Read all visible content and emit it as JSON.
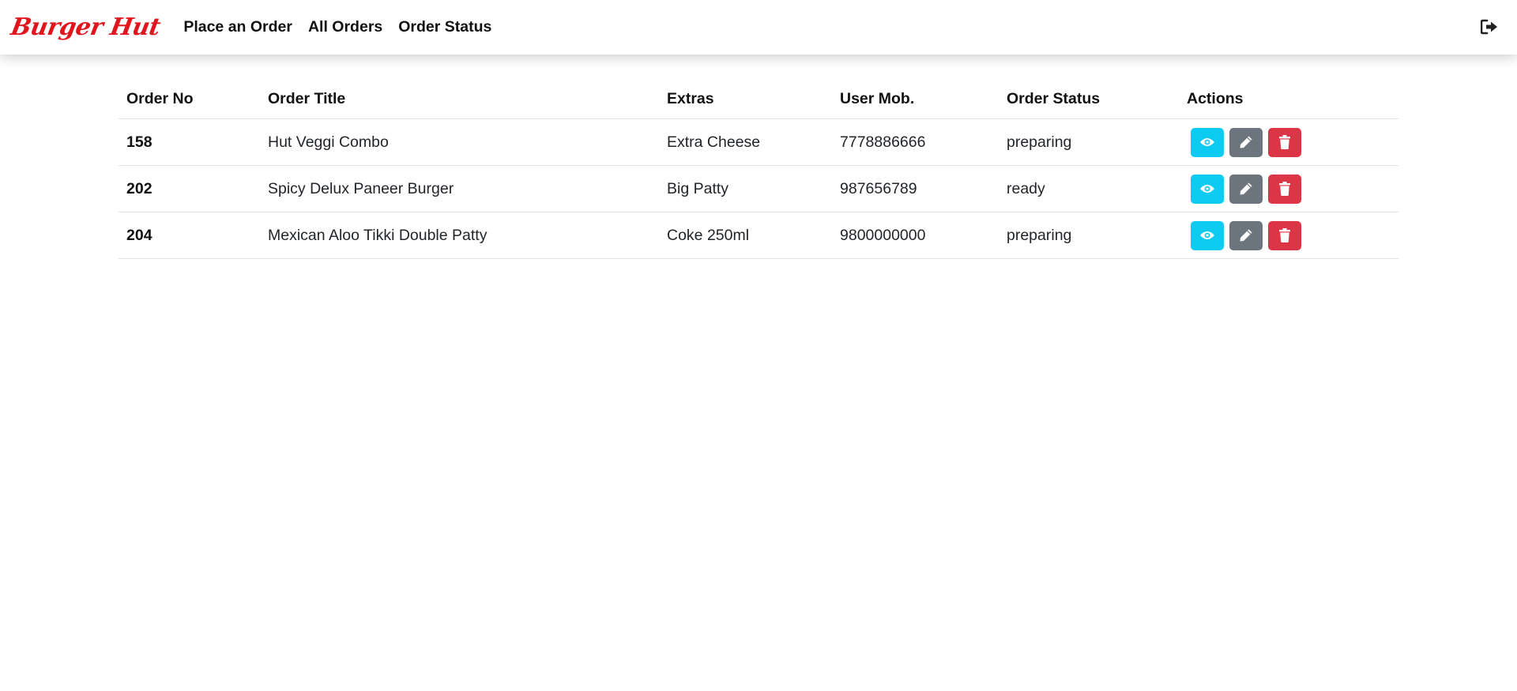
{
  "brand": "Burger Hut",
  "nav": {
    "items": [
      "Place an Order",
      "All Orders",
      "Order Status"
    ]
  },
  "colors": {
    "brand": "#e0151d",
    "view": "#0dcaf0",
    "edit": "#6c757d",
    "delete": "#dc3545"
  },
  "icons": {
    "logout": "sign-out-icon",
    "view": "eye-icon",
    "edit": "pencil-icon",
    "delete": "trash-icon"
  },
  "table": {
    "headers": [
      "Order No",
      "Order Title",
      "Extras",
      "User Mob.",
      "Order Status",
      "Actions"
    ],
    "rows": [
      {
        "order_no": "158",
        "title": "Hut Veggi Combo",
        "extras": "Extra Cheese",
        "mobile": "7778886666",
        "status": "preparing"
      },
      {
        "order_no": "202",
        "title": "Spicy Delux Paneer Burger",
        "extras": "Big Patty",
        "mobile": "987656789",
        "status": "ready"
      },
      {
        "order_no": "204",
        "title": "Mexican Aloo Tikki Double Patty",
        "extras": "Coke 250ml",
        "mobile": "9800000000",
        "status": "preparing"
      }
    ]
  }
}
